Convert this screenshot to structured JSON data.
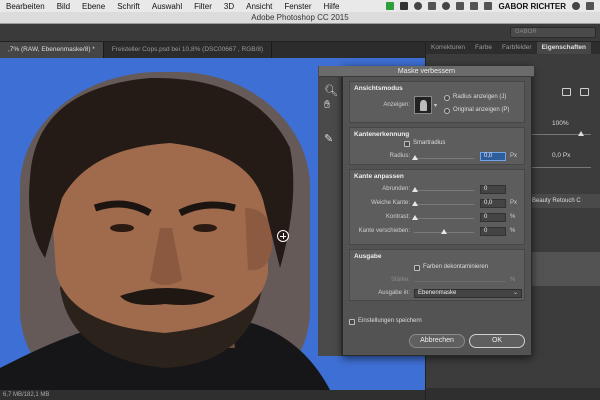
{
  "menubar": {
    "items": [
      "Bearbeiten",
      "Bild",
      "Ebene",
      "Schrift",
      "Auswahl",
      "Filter",
      "3D",
      "Ansicht",
      "Fenster",
      "Hilfe"
    ],
    "user": "GABOR RICHTER"
  },
  "app": {
    "title": "Adobe Photoshop CC 2015"
  },
  "options": {
    "search_placeholder": "GABOR"
  },
  "tabs": [
    {
      "label": ",7% (RAW, Ebenenmaske/8) *",
      "active": true
    },
    {
      "label": "Freisteller Cops.psd bei 10,8% (DSC00667 , RGB/8)",
      "active": false
    }
  ],
  "status": {
    "text": "6,7 MB/182,1 MB"
  },
  "panels": {
    "tabs": [
      "Korrekturen",
      "Farbe",
      "Farbfelder",
      "Eigenschaften"
    ],
    "active_tab": "Eigenschaften",
    "opacity": "100%",
    "feather": "0,0 Px",
    "layer_name": "Beauty Retouch C"
  },
  "dialog": {
    "title": "Maske verbessern",
    "view_mode": {
      "heading": "Ansichtsmodus",
      "show_label": "Anzeigen:",
      "show_radius": "Radius anzeigen (J)",
      "show_original": "Original anzeigen (P)"
    },
    "edge_detection": {
      "heading": "Kantenerkennung",
      "smart_radius": "Smartradius",
      "radius_label": "Radius:",
      "radius_value": "0,0",
      "radius_unit": "Px"
    },
    "adjust_edge": {
      "heading": "Kante anpassen",
      "rows": [
        {
          "label": "Abrunden:",
          "value": "0",
          "unit": ""
        },
        {
          "label": "Weiche Kante:",
          "value": "0,0",
          "unit": "Px"
        },
        {
          "label": "Kontrast:",
          "value": "0",
          "unit": "%"
        },
        {
          "label": "Kante verschieben:",
          "value": "0",
          "unit": "%"
        }
      ]
    },
    "output": {
      "heading": "Ausgabe",
      "decontaminate": "Farben dekontaminieren",
      "strength_label": "Stärke:",
      "strength_unit": "%",
      "output_to_label": "Ausgabe in:",
      "output_to_value": "Ebenenmaske"
    },
    "remember": "Einstellungen speichern",
    "cancel": "Abbrechen",
    "ok": "OK"
  }
}
